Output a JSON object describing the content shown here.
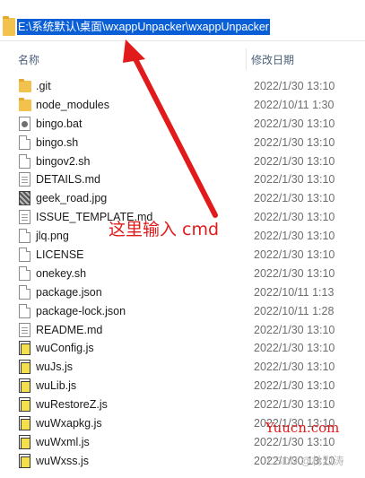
{
  "address_bar": {
    "path": "E:\\系统默认\\桌面\\wxappUnpacker\\wxappUnpacker"
  },
  "columns": {
    "name": "名称",
    "date": "修改日期"
  },
  "files": [
    {
      "name": ".git",
      "date": "2022/1/30 13:10",
      "icon": "folder-icon"
    },
    {
      "name": "node_modules",
      "date": "2022/10/11 1:30",
      "icon": "folder-icon"
    },
    {
      "name": "bingo.bat",
      "date": "2022/1/30 13:10",
      "icon": "gear-icon"
    },
    {
      "name": "bingo.sh",
      "date": "2022/1/30 13:10",
      "icon": "doc-icon"
    },
    {
      "name": "bingov2.sh",
      "date": "2022/1/30 13:10",
      "icon": "doc-icon"
    },
    {
      "name": "DETAILS.md",
      "date": "2022/1/30 13:10",
      "icon": "md-icon"
    },
    {
      "name": "geek_road.jpg",
      "date": "2022/1/30 13:10",
      "icon": "image-icon"
    },
    {
      "name": "ISSUE_TEMPLATE.md",
      "date": "2022/1/30 13:10",
      "icon": "md-icon"
    },
    {
      "name": "jlq.png",
      "date": "2022/1/30 13:10",
      "icon": "doc-icon"
    },
    {
      "name": "LICENSE",
      "date": "2022/1/30 13:10",
      "icon": "doc-icon"
    },
    {
      "name": "onekey.sh",
      "date": "2022/1/30 13:10",
      "icon": "doc-icon"
    },
    {
      "name": "package.json",
      "date": "2022/10/11 1:13",
      "icon": "doc-icon"
    },
    {
      "name": "package-lock.json",
      "date": "2022/10/11 1:28",
      "icon": "doc-icon"
    },
    {
      "name": "README.md",
      "date": "2022/1/30 13:10",
      "icon": "md-icon"
    },
    {
      "name": "wuConfig.js",
      "date": "2022/1/30 13:10",
      "icon": "js-icon"
    },
    {
      "name": "wuJs.js",
      "date": "2022/1/30 13:10",
      "icon": "js-icon"
    },
    {
      "name": "wuLib.js",
      "date": "2022/1/30 13:10",
      "icon": "js-icon"
    },
    {
      "name": "wuRestoreZ.js",
      "date": "2022/1/30 13:10",
      "icon": "js-icon"
    },
    {
      "name": "wuWxapkg.js",
      "date": "2022/1/30 13:10",
      "icon": "js-icon"
    },
    {
      "name": "wuWxml.js",
      "date": "2022/1/30 13:10",
      "icon": "js-icon"
    },
    {
      "name": "wuWxss.js",
      "date": "2022/1/30 13:10",
      "icon": "js-icon"
    }
  ],
  "annotation": {
    "text": "这里输入 cmd",
    "color": "#e11b1b"
  },
  "watermarks": {
    "site": "Yuucn.com",
    "author": "CSDN @林烈涛"
  }
}
